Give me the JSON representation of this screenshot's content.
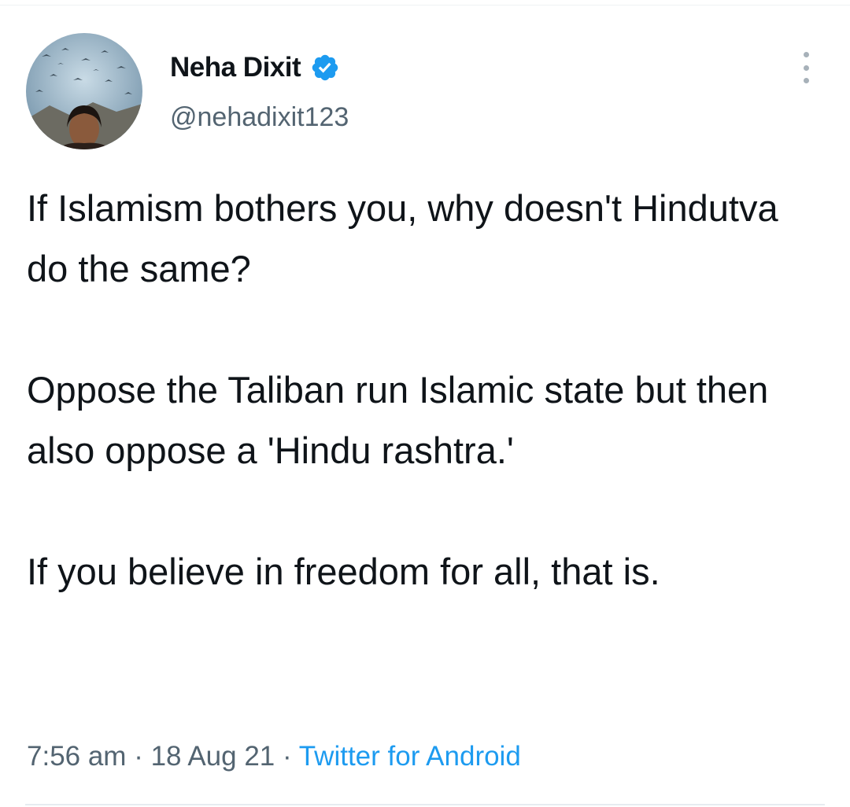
{
  "author": {
    "display_name": "Neha Dixit",
    "handle": "@nehadixit123",
    "verified": true
  },
  "tweet": {
    "paragraphs": [
      "If Islamism bothers you, why doesn't Hindutva do the same?",
      "Oppose the Taliban run Islamic state but then also oppose a 'Hindu rashtra.'",
      "If you believe in freedom for all, that is."
    ]
  },
  "meta": {
    "time": "7:56 am",
    "separator": "·",
    "date": "18 Aug 21",
    "source": "Twitter for Android"
  },
  "colors": {
    "text": "#0f1419",
    "secondary": "#536471",
    "accent": "#1d9bf0"
  },
  "icons": {
    "verified": "verified-badge-icon",
    "more": "more-vertical-icon"
  }
}
